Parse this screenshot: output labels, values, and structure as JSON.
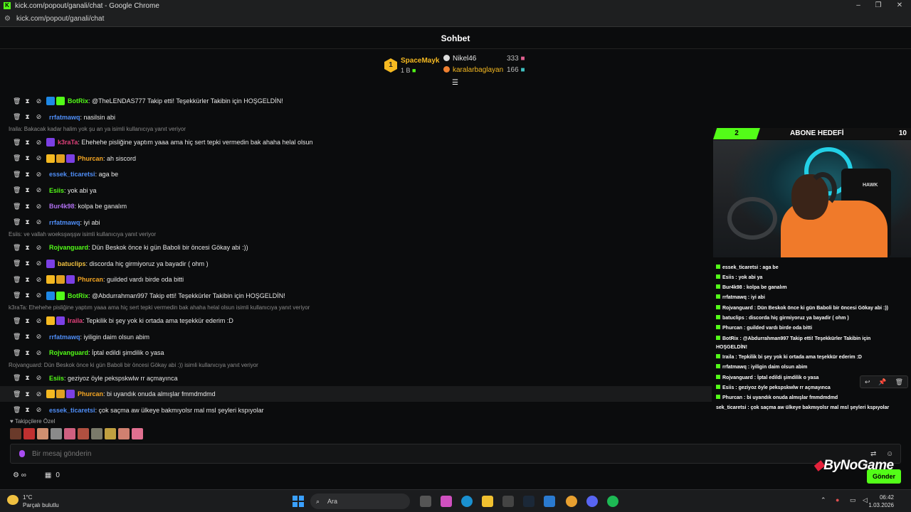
{
  "window": {
    "title": "kick.com/popout/ganali/chat - Google Chrome",
    "url": "kick.com/popout/ganali/chat"
  },
  "chat": {
    "header": "Sohbet"
  },
  "gifters": [
    {
      "rank": "1",
      "name": "SpaceMayk",
      "count": "1 B"
    },
    {
      "name": "Nikel46",
      "count": "333",
      "color": "#ffffff"
    },
    {
      "name": "karalarbaglayan",
      "count": "166",
      "color": "#f5b921"
    }
  ],
  "messages": [
    {
      "user": "BotRix",
      "color": "#53fc18",
      "text": ": @TheLENDAS777 Takip etti! Teşekkürler Takibin için HOŞGELDİN!",
      "badges": [
        "#1e88e5",
        "#53fc18"
      ]
    },
    {
      "user": "rrfatmawq",
      "color": "#4f8ef7",
      "text": ": nasilsin abi",
      "badges": []
    },
    {
      "reply": "Iraila: Bakacak kadar halim yok şu an ya isimli kullanıcıya yanıt veriyor"
    },
    {
      "user": "k3raTa",
      "color": "#e0407a",
      "text": ": Ehehehe pisliğine yaptım yaaa ama hiç sert tepki vermedin bak ahaha helal olsun",
      "badges": [
        "#7b3fe4"
      ]
    },
    {
      "user": "Phurcan",
      "color": "#f5a623",
      "text": ": ah siscord",
      "badges": [
        "#f5b921",
        "#e0a020",
        "#7b3fe4"
      ]
    },
    {
      "user": "essek_ticaretsi",
      "color": "#4f8ef7",
      "text": ": aga be",
      "badges": []
    },
    {
      "user": "Esiis",
      "color": "#53fc18",
      "text": ": yok abi ya",
      "badges": []
    },
    {
      "user": "Bur4k98",
      "color": "#b070f0",
      "text": ": kolpa be ganalım",
      "badges": []
    },
    {
      "user": "rrfatmawq",
      "color": "#4f8ef7",
      "text": ": iyi abi",
      "badges": []
    },
    {
      "reply": "Esiis: ve vallah woeksşwşşw isimli kullanıcıya yanıt veriyor"
    },
    {
      "user": "Rojvanguard",
      "color": "#53fc18",
      "text": ": Dün Beskok önce ki gün Baboli bir öncesi Gökay abi :))",
      "badges": []
    },
    {
      "user": "batuclips",
      "color": "#f0c040",
      "text": ": discorda hiç girmiyoruz ya bayadir ( ohm )",
      "badges": [
        "#7b3fe4"
      ]
    },
    {
      "user": "Phurcan",
      "color": "#f5a623",
      "text": ": guilded vardı birde oda bitti",
      "badges": [
        "#f5b921",
        "#e0a020",
        "#7b3fe4"
      ]
    },
    {
      "user": "BotRix",
      "color": "#53fc18",
      "text": ": @Abdurrahman997 Takip etti! Teşekkürler Takibin için HOŞGELDİN!",
      "badges": [
        "#1e88e5",
        "#53fc18"
      ]
    },
    {
      "reply": "k3raTa: Ehehehe pisliğine yaptım yaaa ama hiç sert tepki vermedin bak ahaha helal olsun isimli kullanıcıya yanıt veriyor"
    },
    {
      "user": "Iraila",
      "color": "#e0407a",
      "text": ": Tepkilik bi şey yok ki ortada ama teşekkür ederim :D",
      "badges": [
        "#f5b921",
        "#7b3fe4"
      ]
    },
    {
      "user": "rrfatmawq",
      "color": "#4f8ef7",
      "text": ": iyiligin daim olsun abim",
      "badges": []
    },
    {
      "user": "Rojvanguard",
      "color": "#53fc18",
      "text": ": İptal edildi şimdilik o yasa",
      "badges": []
    },
    {
      "reply": "Rojvanguard: Dün Beskok önce ki gün Baboli bir öncesi Gökay abi :)) isimli kullanıcıya yanıt veriyor"
    },
    {
      "user": "Esiis",
      "color": "#53fc18",
      "text": ": geziyoz öyle pekspskwlw rr açmayınca",
      "badges": []
    },
    {
      "user": "Phurcan",
      "color": "#f5a623",
      "text": ": bi uyandık onuda almışlar fmmdmdmd",
      "badges": [
        "#f5b921",
        "#e0a020",
        "#7b3fe4"
      ]
    },
    {
      "user": "essek_ticaretsi",
      "color": "#4f8ef7",
      "text": ": çok saçma aw ülkeye bakmıyolsr mal msl şeyleri kspıyolar",
      "badges": []
    }
  ],
  "followers_only": "Takipçilere Özel",
  "input": {
    "placeholder": "Bir mesaj gönderin",
    "send": "Gönder"
  },
  "bottom": {
    "count": "0"
  },
  "overlay": {
    "goal": {
      "current": "2",
      "title": "ABONE HEDEFİ",
      "target": "10"
    },
    "chair_text": "HAWK",
    "brand": "ByNoGame",
    "lines": [
      "essek_ticaretsi : aga be",
      "Esiis : yok abi ya",
      "Bur4k98 : kolpa be ganalım",
      "rrfatmawq : iyi abi",
      "Rojvanguard : Dün Beskok önce ki gün Baboli bir öncesi Gökay abi :))",
      "batuclips : discorda hiç girmiyoruz ya bayadir ( ohm )",
      "Phurcan : guilded vardı birde oda bitti",
      "BotRix : @Abdurrahman997 Takip etti! Teşekkürler Takibin için",
      "HOŞGELDİN!",
      "Iraila : Tepkilik bi şey yok ki ortada ama teşekkür ederim :D",
      "rrfatmawq : iyiligin daim olsun abim",
      "Rojvanguard : İptal edildi şimdilik o yasa",
      "Esiis : geziyoz öyle pekspskwlw rr açmayınca",
      "Phurcan : bi uyandık onuda almışlar fmmdmdmd",
      "sek_ticaretsi : çok saçma aw ülkeye bakmıyolsr mal msl şeyleri kspıyolar"
    ]
  },
  "taskbar": {
    "temp": "1°C",
    "weather": "Parçalı bulutlu",
    "search": "Ara",
    "time": "06:42",
    "date": "1.03.2026"
  }
}
